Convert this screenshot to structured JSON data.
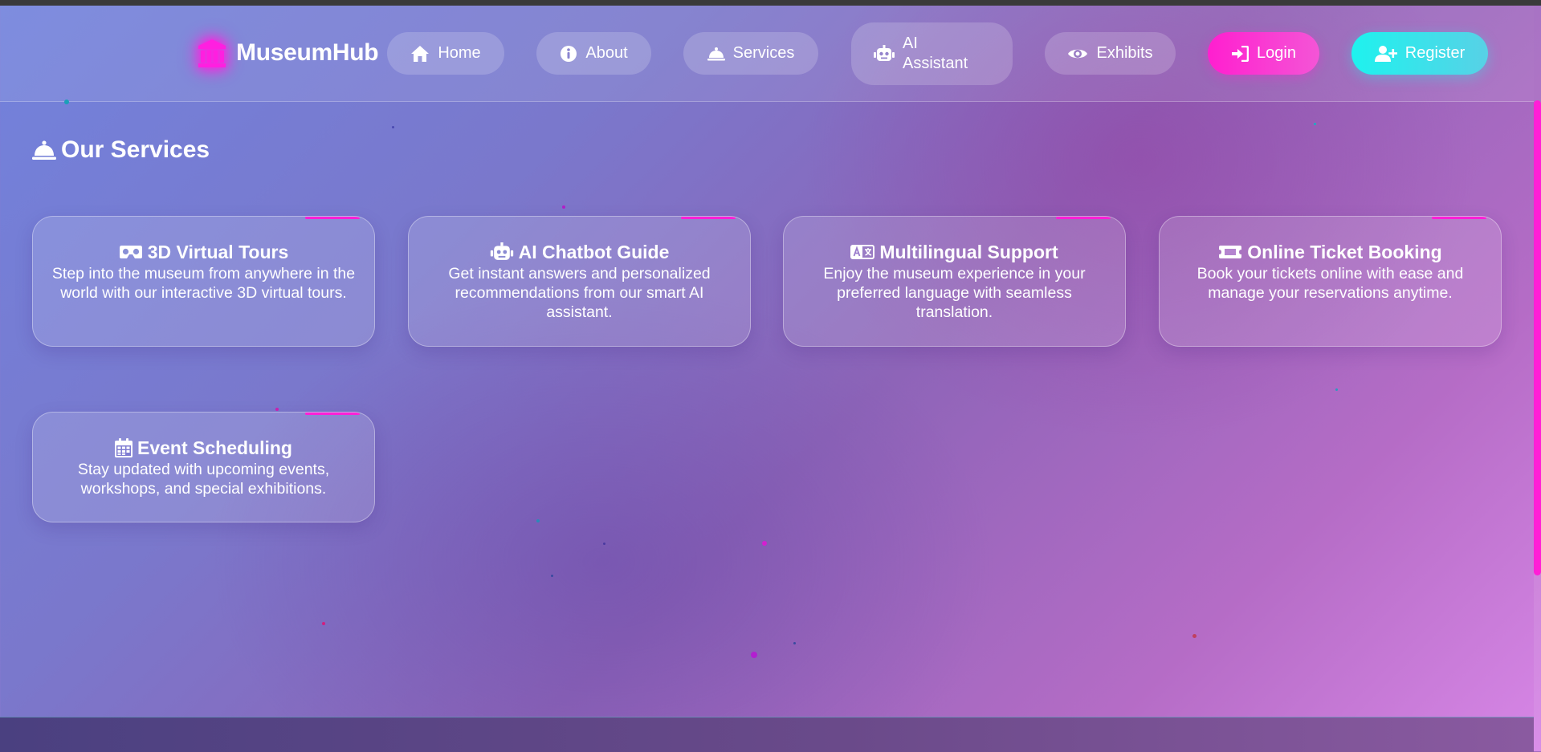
{
  "brand": {
    "name": "MuseumHub",
    "icon": "museum-icon",
    "glow_color": "#ff1fe0"
  },
  "nav": {
    "home": "Home",
    "about": "About",
    "services": "Services",
    "ai_assistant_line1": "AI",
    "ai_assistant_line2": "Assistant",
    "exhibits": "Exhibits",
    "login": "Login",
    "register": "Register"
  },
  "colors": {
    "login": "#ff1fcf",
    "register": "#1ef2ee",
    "accent": "#ff1fd6"
  },
  "section": {
    "title": "Our Services",
    "icon": "bell-service-icon"
  },
  "services": [
    {
      "icon": "vr-goggles-icon",
      "title": "3D Virtual Tours",
      "description": "Step into the museum from anywhere in the world with our interactive 3D virtual tours."
    },
    {
      "icon": "robot-icon",
      "title": "AI Chatbot Guide",
      "description": "Get instant answers and personalized recommendations from our smart AI assistant."
    },
    {
      "icon": "language-icon",
      "title": "Multilingual Support",
      "description": "Enjoy the museum experience in your preferred language with seamless translation."
    },
    {
      "icon": "ticket-icon",
      "title": "Online Ticket Booking",
      "description": "Book your tickets online with ease and manage your reservations anytime."
    },
    {
      "icon": "calendar-icon",
      "title": "Event Scheduling",
      "description": "Stay updated with upcoming events, workshops, and special exhibitions."
    }
  ]
}
